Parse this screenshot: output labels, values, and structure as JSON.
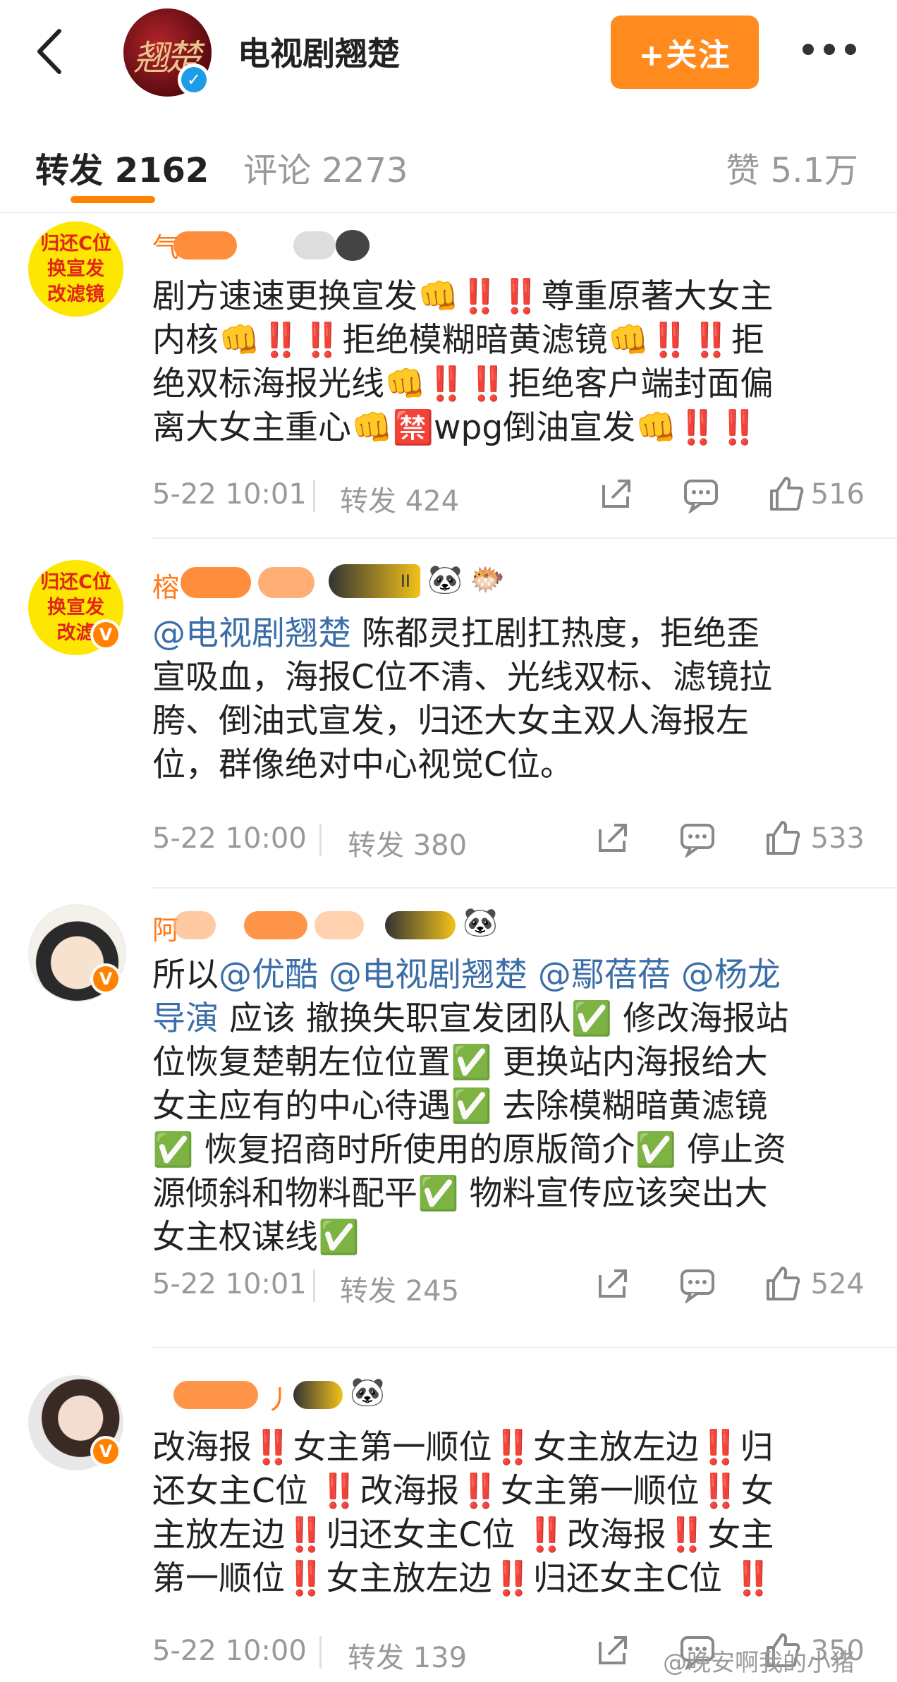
{
  "header": {
    "back_label": "",
    "title": "电视剧翘楚",
    "avatar_text": "翘楚",
    "follow_label": "+关注"
  },
  "tabs": {
    "repost": "转发 2162",
    "comment": "评论 2273",
    "like": "赞 5.1万"
  },
  "posts": [
    {
      "avatar_sticker": [
        "归还C位",
        "换宣发",
        "改滤镜"
      ],
      "nick": "气",
      "lines": [
        "剧方速速更换宣发👊‼️‼️尊重原著大女主",
        "内核👊‼️‼️拒绝模糊暗黄滤镜👊‼️‼️拒",
        "绝双标海报光线👊‼️‼️拒绝客户端封面偏",
        "离大女主重心👊🈲wpg倒油宣发👊‼️‼️"
      ],
      "time": "5-22 10:01",
      "repost": "转发 424",
      "likes": "516"
    },
    {
      "avatar_sticker": [
        "归还C位",
        "换宣发",
        "改滤"
      ],
      "nick": "榕",
      "badge_level": "II",
      "mention": "@电视剧翘楚",
      "lines": [
        " 陈都灵扛剧扛热度，拒绝歪",
        "宣吸血，海报C位不清、光线双标、滤镜拉",
        "胯、倒油式宣发，归还大女主双人海报左",
        "位，群像绝对中心视觉C位。"
      ],
      "time": "5-22 10:00",
      "repost": "转发 380",
      "likes": "533"
    },
    {
      "nick": "阿",
      "mentions_line1": [
        "所以",
        "@优酷",
        " ",
        "@电视剧翘楚",
        " ",
        "@鄢蓓蓓",
        " ",
        "@杨龙"
      ],
      "mention_line2": "导演",
      "lines": [
        " 应该 撤换失职宣发团队✅ 修改海报站",
        "位恢复楚朝左位位置✅ 更换站内海报给大",
        "女主应有的中心待遇✅ 去除模糊暗黄滤镜",
        "✅ 恢复招商时所使用的原版简介✅ 停止资",
        "源倾斜和物料配平✅ 物料宣传应该突出大",
        "女主权谋线✅"
      ],
      "time": "5-22 10:01",
      "repost": "转发 245",
      "likes": "524"
    },
    {
      "nick": "丿",
      "lines": [
        "改海报‼️女主第一顺位‼️女主放左边‼️归",
        "还女主C位 ‼️改海报‼️女主第一顺位‼️女",
        "主放左边‼️归还女主C位 ‼️改海报‼️女主",
        "第一顺位‼️女主放左边‼️归还女主C位 ‼️"
      ],
      "time": "5-22 10:00",
      "repost": "转发 139",
      "likes": "350"
    }
  ],
  "watermark": "@晚安啊我的小猪",
  "colors": {
    "accent": "#ff8200",
    "follow_bg": "#ff8a1e",
    "mention": "#3b6ea8",
    "verified_orange": "#ff8200",
    "verified_blue": "#1e9ce8",
    "warning_red": "#e0191e",
    "check_green": "#3cb34a"
  },
  "icons": [
    "back-chevron-icon",
    "more-dots-icon",
    "share-icon",
    "comment-icon",
    "thumbs-up-icon",
    "verified-icon"
  ]
}
